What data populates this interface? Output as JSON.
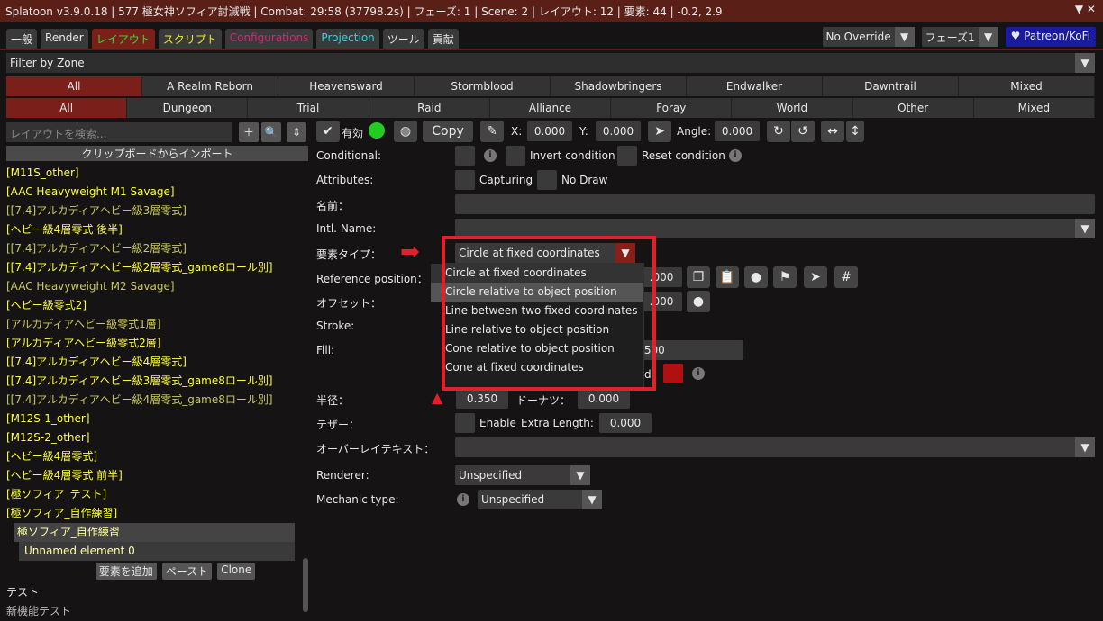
{
  "title": "Splatoon v3.9.0.18 | 577 極女神ソフィア討滅戦 | Combat: 29:58 (37798.2s) | フェーズ: 1 | Scene: 2 | レイアウト: 12 | 要素: 44 | -0.2, 2.9",
  "tabs": [
    {
      "label": "一般",
      "color": "#e8e8e8"
    },
    {
      "label": "Render",
      "color": "#e8e8e8"
    },
    {
      "label": "レイアウト",
      "color": "#33dd33"
    },
    {
      "label": "スクリプト",
      "color": "#eeee22"
    },
    {
      "label": "Configurations",
      "color": "#e0207a"
    },
    {
      "label": "Projection",
      "color": "#22dddd"
    },
    {
      "label": "ツール",
      "color": "#e8e8e8"
    },
    {
      "label": "貢献",
      "color": "#e8e8e8"
    }
  ],
  "override": "No Override",
  "phase": "フェーズ1",
  "patreon": "♥ Patreon/KoFi",
  "filter": "Filter by Zone",
  "expansions": [
    "All",
    "A Realm Reborn",
    "Heavensward",
    "Stormblood",
    "Shadowbringers",
    "Endwalker",
    "Dawntrail",
    "Mixed"
  ],
  "content_types": [
    "All",
    "Dungeon",
    "Trial",
    "Raid",
    "Alliance",
    "Foray",
    "World",
    "Other",
    "Mixed"
  ],
  "left": {
    "search_placeholder": "レイアウトを検索...",
    "import": "クリップボードからインポート",
    "items": [
      {
        "t": "[M11S_other]",
        "dim": false
      },
      {
        "t": "[AAC Heavyweight M1 Savage]",
        "dim": false
      },
      {
        "t": "[[7.4]アルカディアヘビー級3層零式]",
        "dim": true
      },
      {
        "t": "[ヘビー級4層零式 後半]",
        "dim": false
      },
      {
        "t": "[[7.4]アルカディアヘビー級2層零式]",
        "dim": true
      },
      {
        "t": "[[7.4]アルカディアヘビー級2層零式_game8ロール別]",
        "dim": false
      },
      {
        "t": "[AAC Heavyweight M2 Savage]",
        "dim": true
      },
      {
        "t": "[ヘビー級零式2]",
        "dim": false
      },
      {
        "t": "[アルカディアヘビー級零式1層]",
        "dim": true
      },
      {
        "t": "[アルカディアヘビー級零式2層]",
        "dim": false
      },
      {
        "t": "[[7.4]アルカディアヘビー級4層零式]",
        "dim": false
      },
      {
        "t": "[[7.4]アルカディアヘビー級3層零式_game8ロール別]",
        "dim": false
      },
      {
        "t": "[[7.4]アルカディアヘビー級4層零式_game8ロール別]",
        "dim": true
      },
      {
        "t": "[M12S-1_other]",
        "dim": false
      },
      {
        "t": "[M12S-2_other]",
        "dim": false
      },
      {
        "t": "[ヘビー級4層零式]",
        "dim": false
      },
      {
        "t": "[ヘビー級4層零式 前半]",
        "dim": false
      },
      {
        "t": "[極ソフィア_テスト]",
        "dim": false
      },
      {
        "t": "[極ソフィア_自作練習]",
        "dim": false
      }
    ],
    "selected_layout": "極ソフィア_自作練習",
    "selected_element": "Unnamed element 0",
    "add_element": "要素を追加",
    "paste": "ペースト",
    "clone": "Clone",
    "test": "テスト",
    "new_test": "新機能テスト"
  },
  "main": {
    "enabled": "有効",
    "copy": "Copy",
    "x_label": "X:",
    "x": "0.000",
    "y_label": "Y:",
    "y": "0.000",
    "angle_label": "Angle:",
    "angle": "0.000",
    "conditional": "Conditional:",
    "invert": "Invert condition",
    "reset": "Reset condition",
    "attributes": "Attributes:",
    "capturing": "Capturing",
    "nodraw": "No Draw",
    "name": "名前：",
    "intl_name": "Intl. Name:",
    "element_type": "要素タイプ：",
    "element_type_value": "Circle at fixed coordinates",
    "reference": "Reference position：",
    "offset": "オフセット：",
    "stroke": "Stroke:",
    "fill": "Fill:",
    "ref_val": ".000",
    "off_val": ".000",
    "fill_val": ".500",
    "fill_suffix": "d",
    "radius": "半径：",
    "radius_val": "0.350",
    "donut": "ドーナツ：",
    "donut_val": "0.000",
    "tether": "テザー：",
    "tether_enable": "Enable",
    "extra_length": "Extra Length:",
    "extra_val": "0.000",
    "overlay": "オーバーレイテキスト：",
    "renderer": "Renderer:",
    "renderer_val": "Unspecified",
    "mechanic": "Mechanic type:",
    "mechanic_val": "Unspecified",
    "options": [
      "Circle at fixed coordinates",
      "Circle relative to object position",
      "Line between two fixed coordinates",
      "Line relative to object position",
      "Cone relative to object position",
      "Cone at fixed coordinates"
    ]
  },
  "colors": {
    "accent": "#7a1f1a",
    "annotation": "#e2202c",
    "fill_swatch": "#b01010"
  }
}
